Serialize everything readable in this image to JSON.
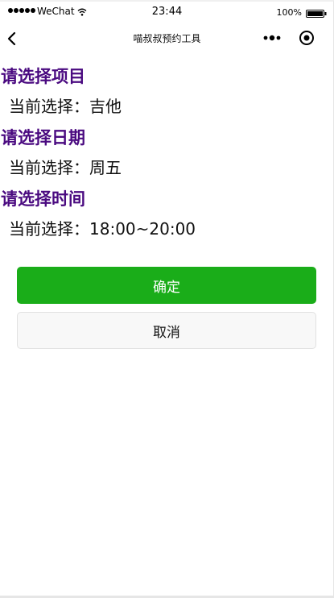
{
  "status_bar": {
    "carrier": "WeChat",
    "time": "23:44",
    "battery": "100%"
  },
  "nav_bar": {
    "title": "喵叔叔预约工具"
  },
  "sections": [
    {
      "title": "请选择项目",
      "current_label": "当前选择：",
      "current_value": "吉他"
    },
    {
      "title": "请选择日期",
      "current_label": "当前选择：",
      "current_value": "周五"
    },
    {
      "title": "请选择时间",
      "current_label": "当前选择：",
      "current_value": "18:00~20:00"
    }
  ],
  "buttons": {
    "confirm_label": "确定",
    "cancel_label": "取消"
  },
  "colors": {
    "section_title": "#4a0a80",
    "confirm_bg": "#1aad19",
    "cancel_bg": "#f8f8f8"
  },
  "icons": {
    "back": "back-arrow-icon",
    "more": "more-dots-icon",
    "target": "target-circle-icon",
    "wifi": "wifi-icon",
    "battery": "battery-icon",
    "signal": "signal-dots-icon"
  }
}
